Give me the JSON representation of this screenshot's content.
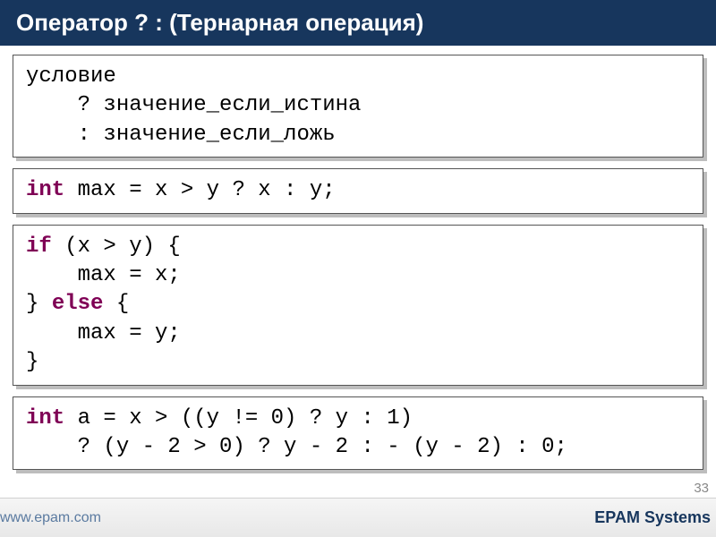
{
  "title": "Оператор ? : (Тернарная операция)",
  "boxes": {
    "syntax": {
      "line1": "условие",
      "line2": "    ? значение_если_истина",
      "line3": "    : значение_если_ложь"
    },
    "example1": {
      "kw": "int",
      "rest": " max = x > y ? x : y;"
    },
    "ifelse": {
      "if": "if",
      "cond": " (x > y) {",
      "body1": "    max = x;",
      "close1": "} ",
      "else": "else",
      "open2": " {",
      "body2": "    max = y;",
      "close2": "}"
    },
    "example2": {
      "kw": "int",
      "line1_rest": " a = x > ((y != 0) ? y : 1)",
      "line2": "    ? (y - 2 > 0) ? y - 2 : - (y - 2) : 0;"
    }
  },
  "footer": {
    "left": "www.epam.com",
    "right": "EPAM Systems"
  },
  "page_number": "33"
}
